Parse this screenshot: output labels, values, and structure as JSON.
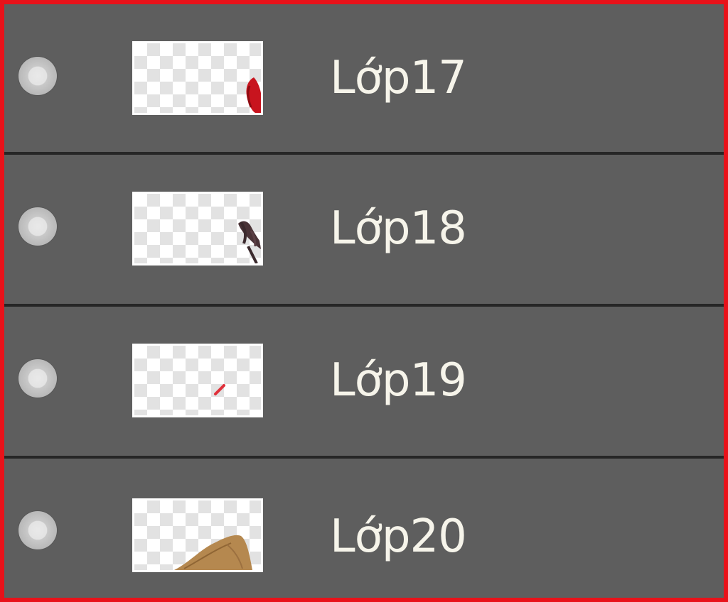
{
  "layers_panel": {
    "layers": [
      {
        "name": "Lớp17",
        "thumbnail_icon": "red-drop-thumbnail"
      },
      {
        "name": "Lớp18",
        "thumbnail_icon": "dark-hair-strands-thumbnail"
      },
      {
        "name": "Lớp19",
        "thumbnail_icon": "small-red-stroke-thumbnail"
      },
      {
        "name": "Lớp20",
        "thumbnail_icon": "brown-shape-thumbnail"
      }
    ]
  },
  "colors": {
    "panel_background": "#5e5e5e",
    "divider": "#262626",
    "frame_border": "#e8121a",
    "text": "#f6f4ea"
  }
}
